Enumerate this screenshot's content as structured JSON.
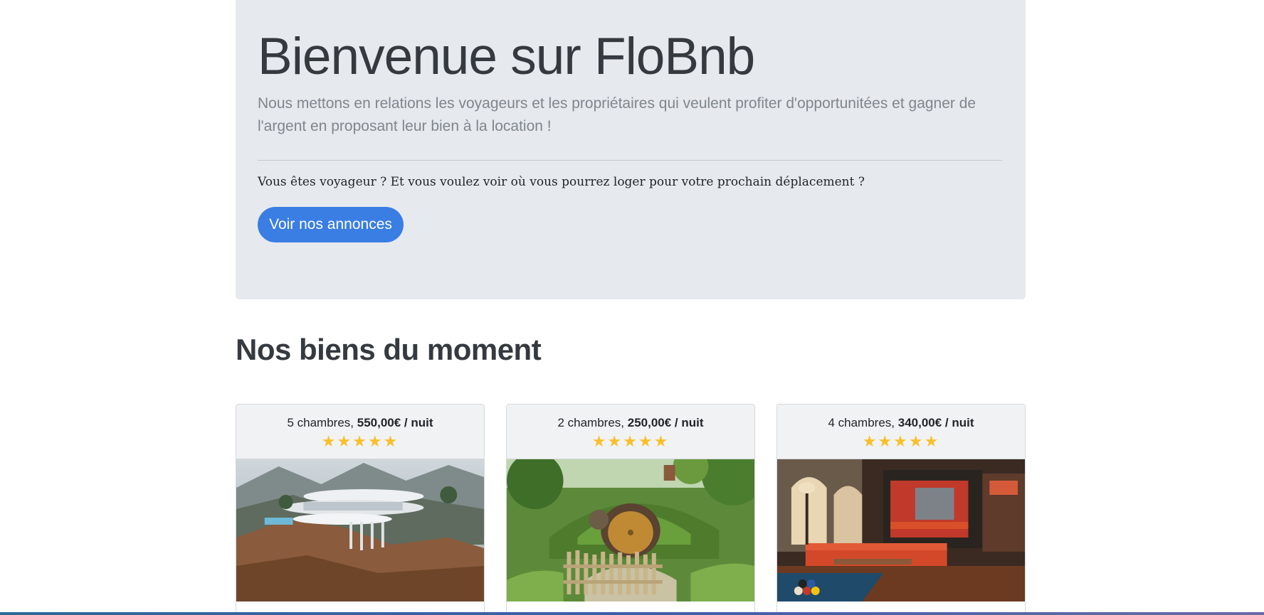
{
  "hero": {
    "title": "Bienvenue sur FloBnb",
    "lead": "Nous mettons en relations les voyageurs et les propriétaires qui veulent profiter d'opportunitées et gagner de l'argent en proposant leur bien à la location !",
    "question": "Vous êtes voyageur ? Et vous voulez voir où vous pourrez loger pour votre prochain déplacement ?",
    "cta_label": "Voir nos annonces"
  },
  "section": {
    "title": "Nos biens du moment"
  },
  "listings": [
    {
      "rooms": "5 chambres,",
      "price": "550,00€ / nuit",
      "rating": 5,
      "stars": "★★★★★",
      "image": "modern-cliff-villa"
    },
    {
      "rooms": "2 chambres,",
      "price": "250,00€ / nuit",
      "rating": 5,
      "stars": "★★★★★",
      "image": "hobbit-hole-house"
    },
    {
      "rooms": "4 chambres,",
      "price": "340,00€ / nuit",
      "rating": 5,
      "stars": "★★★★★",
      "image": "living-room-pool-table"
    }
  ],
  "colors": {
    "jumbotron_bg": "#e6e9ed",
    "primary": "#3a7ee4",
    "star": "#f7c02b",
    "heading": "#343a40",
    "lead": "#7f868e"
  }
}
